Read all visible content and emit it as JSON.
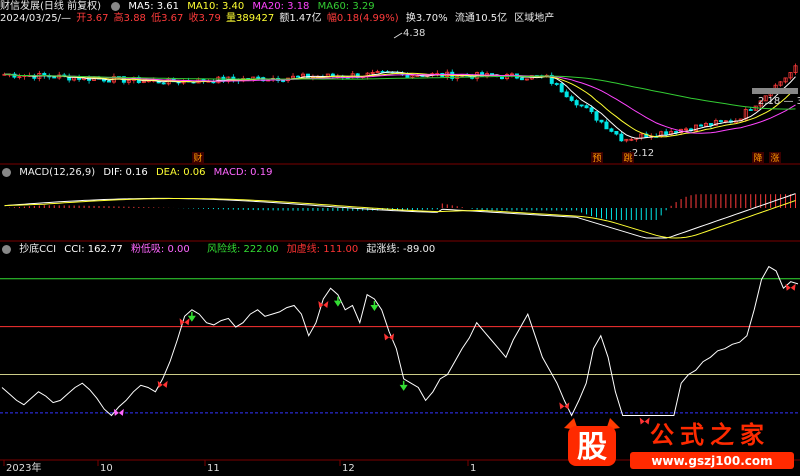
{
  "colors": {
    "up": "#ff3b3b",
    "down": "#00e6e6",
    "ma5": "#ffffff",
    "ma10": "#ffff33",
    "ma20": "#ff44ff",
    "ma60": "#33cc33",
    "dea": "#ffff33",
    "dif": "#ffffff",
    "grid": "#7a0000",
    "purple": "#cc66ff",
    "green": "#33dd33",
    "red": "#ff3333",
    "magenta": "#ff66ff"
  },
  "header1": {
    "title": "财信发展(日线 前复权)",
    "ma5": "MA5: 3.61",
    "ma10": "MA10: 3.40",
    "ma20": "MA20: 3.18",
    "ma60": "MA60: 3.29"
  },
  "header2": {
    "date": "2024/03/25/—",
    "open": "开3.67",
    "high": "高3.88",
    "low": "低3.67",
    "close": "收3.79",
    "vol": "量389427",
    "amount": "额1.47亿",
    "change": "幅0.18(4.99%)",
    "turnover": "换3.70%",
    "float": "流通10.5亿",
    "sector": "区域地产"
  },
  "price_labels": {
    "high": "4.38",
    "low": "2.12",
    "right": "2.18 — 3.29"
  },
  "markers": {
    "cai": "财",
    "yu": "预",
    "tiao": "跳",
    "jiang": "降",
    "zhang": "涨"
  },
  "macd_header": {
    "name": "MACD(12,26,9)",
    "dif": "DIF: 0.16",
    "dea": "DEA: 0.06",
    "macd": "MACD: 0.19"
  },
  "cci_header": {
    "name": "抄底CCI",
    "cci": "CCI: 162.77",
    "low": "粉低吸: 0.00",
    "risk": "风险线: 222.00",
    "add": "加虚线: 111.00",
    "rise": "起涨线: -89.00"
  },
  "xaxis": {
    "labels": [
      "2023年",
      "10",
      "11",
      "12",
      "1"
    ]
  },
  "logo": {
    "big": "股",
    "name": "公式之家",
    "url": "www.gszj100.com"
  },
  "chart_data": [
    {
      "type": "candlestick",
      "title": "财信发展(日线 前复权)",
      "series_names": [
        "MA5",
        "MA10",
        "MA20",
        "MA60"
      ],
      "annotations": [
        {
          "text": "4.38",
          "kind": "high"
        },
        {
          "text": "2.12",
          "kind": "low"
        }
      ]
    },
    {
      "type": "bar",
      "title": "MACD(12,26,9)",
      "series_names": [
        "DIF",
        "DEA",
        "MACD"
      ]
    },
    {
      "type": "line",
      "title": "抄底CCI",
      "values_last": 162.77,
      "reference_lines": [
        222.0,
        111.0,
        -89.0
      ],
      "cci": [
        -30,
        -45,
        -60,
        -70,
        -55,
        -40,
        -50,
        -65,
        -60,
        -45,
        -30,
        -20,
        -35,
        -55,
        -80,
        -95,
        -75,
        -60,
        -40,
        -25,
        -30,
        -40,
        -10,
        30,
        80,
        135,
        150,
        140,
        120,
        115,
        125,
        130,
        110,
        120,
        140,
        150,
        135,
        140,
        145,
        155,
        160,
        140,
        90,
        120,
        175,
        200,
        185,
        150,
        160,
        120,
        185,
        175,
        150,
        100,
        60,
        -10,
        -20,
        -30,
        -60,
        -40,
        -10,
        0,
        30,
        60,
        85,
        120,
        100,
        80,
        60,
        40,
        80,
        110,
        140,
        90,
        40,
        10,
        -20,
        -60,
        -95,
        -60,
        -20,
        60,
        90,
        40,
        -40,
        -95,
        -95,
        -95,
        -95,
        -95,
        -95,
        -95,
        -95,
        -20,
        0,
        10,
        30,
        40,
        55,
        60,
        70,
        75,
        90,
        150,
        220,
        250,
        240,
        200,
        215,
        210
      ]
    }
  ]
}
